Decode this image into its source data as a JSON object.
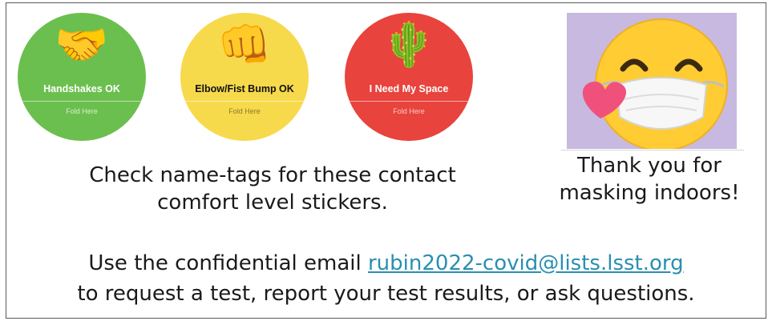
{
  "stickers": [
    {
      "emoji": "🤝",
      "label": "Handshakes OK",
      "fold": "Fold Here",
      "bg": "#6bbf4e",
      "text": "#ffffff",
      "foldColor": "#d7efcf"
    },
    {
      "emoji": "👊",
      "label": "Elbow/Fist Bump OK",
      "fold": "Fold Here",
      "bg": "#f7d94c",
      "text": "#111111",
      "foldColor": "#8a7a2a"
    },
    {
      "emoji": "🌵",
      "label": "I Need My Space",
      "fold": "Fold Here",
      "bg": "#e8433d",
      "text": "#ffffff",
      "foldColor": "#f7c9c6"
    }
  ],
  "caption_left": {
    "line1": "Check name-tags for these contact",
    "line2": "comfort level stickers."
  },
  "caption_right": {
    "line1": "Thank you for",
    "line2": "masking indoors!"
  },
  "bottom": {
    "prefix": "Use the confidential email ",
    "email": "rubin2022-covid@lists.lsst.org",
    "line2": "to request a test, report your test results, or ask questions."
  },
  "colors": {
    "link": "#2a8fb0",
    "mask_panel": "#c7b9e0",
    "emoji_face": "#ffcc33",
    "heart": "#f0507c"
  }
}
